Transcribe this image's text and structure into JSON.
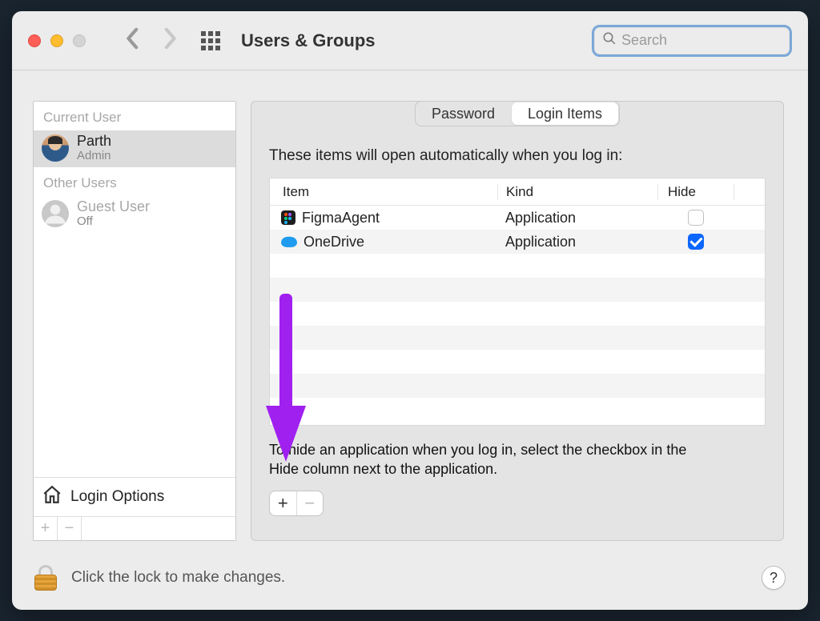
{
  "window": {
    "title": "Users & Groups"
  },
  "search": {
    "placeholder": "Search",
    "value": ""
  },
  "sidebar": {
    "current_label": "Current User",
    "other_label": "Other Users",
    "current_user": {
      "name": "Parth",
      "role": "Admin"
    },
    "other_users": [
      {
        "name": "Guest User",
        "role": "Off"
      }
    ],
    "login_options_label": "Login Options"
  },
  "tabs": {
    "password": "Password",
    "login_items": "Login Items",
    "active": "login_items"
  },
  "login_items": {
    "intro": "These items will open automatically when you log in:",
    "columns": {
      "item": "Item",
      "kind": "Kind",
      "hide": "Hide"
    },
    "rows": [
      {
        "name": "FigmaAgent",
        "kind": "Application",
        "hide": false,
        "icon": "figma"
      },
      {
        "name": "OneDrive",
        "kind": "Application",
        "hide": true,
        "icon": "onedrive"
      }
    ],
    "hint": "To hide an application when you log in, select the checkbox in the Hide column next to the application."
  },
  "footer": {
    "lock_text": "Click the lock to make changes.",
    "help_label": "?"
  },
  "colors": {
    "accent": "#0a66ff",
    "annotation": "#a020f0"
  }
}
